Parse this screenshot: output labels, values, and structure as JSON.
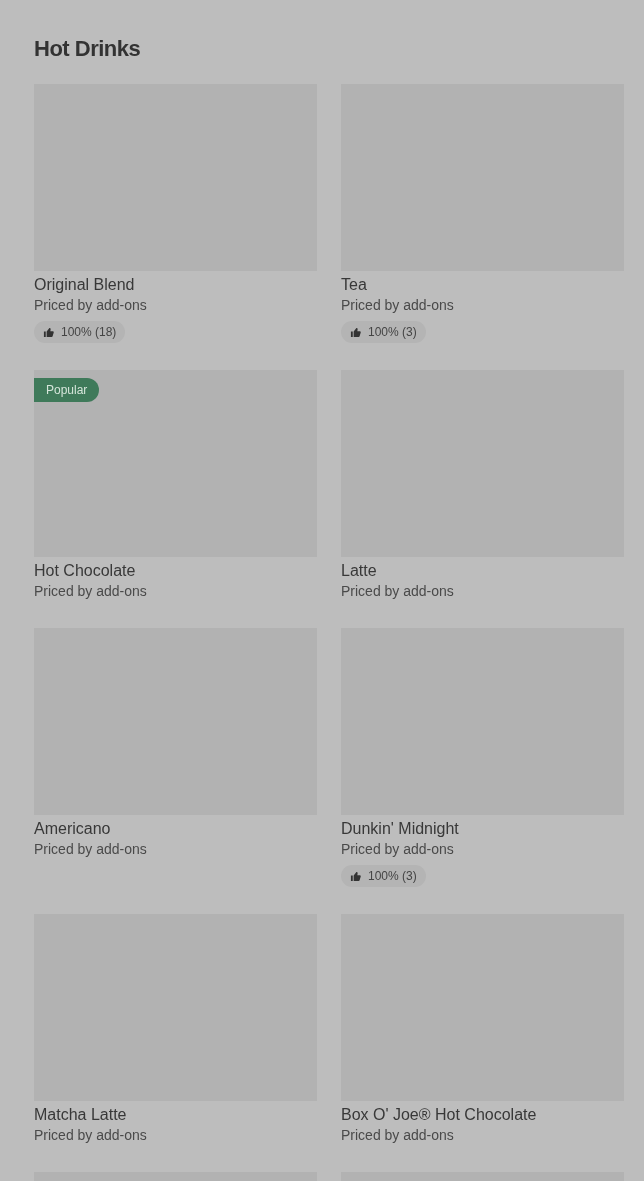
{
  "section": {
    "title": "Hot Drinks"
  },
  "items": [
    {
      "kind": "product",
      "name": "Original Blend",
      "price": "Priced by add-ons",
      "rating": "100% (18)"
    },
    {
      "kind": "product",
      "name": "Tea",
      "price": "Priced by add-ons",
      "rating": "100% (3)"
    },
    {
      "kind": "product",
      "name": "Hot Chocolate",
      "price": "Priced by add-ons",
      "badge": "Popular"
    },
    {
      "kind": "product",
      "name": "Latte",
      "price": "Priced by add-ons"
    },
    {
      "kind": "product",
      "name": "Americano",
      "price": "Priced by add-ons"
    },
    {
      "kind": "product",
      "name": "Dunkin' Midnight",
      "price": "Priced by add-ons",
      "rating": "100% (3)"
    },
    {
      "kind": "product",
      "name": "Matcha Latte",
      "price": "Priced by add-ons"
    },
    {
      "kind": "product",
      "name": "Box O' Joe® Hot Chocolate",
      "price": "Priced by add-ons"
    },
    {
      "kind": "picture"
    },
    {
      "kind": "picture"
    }
  ]
}
